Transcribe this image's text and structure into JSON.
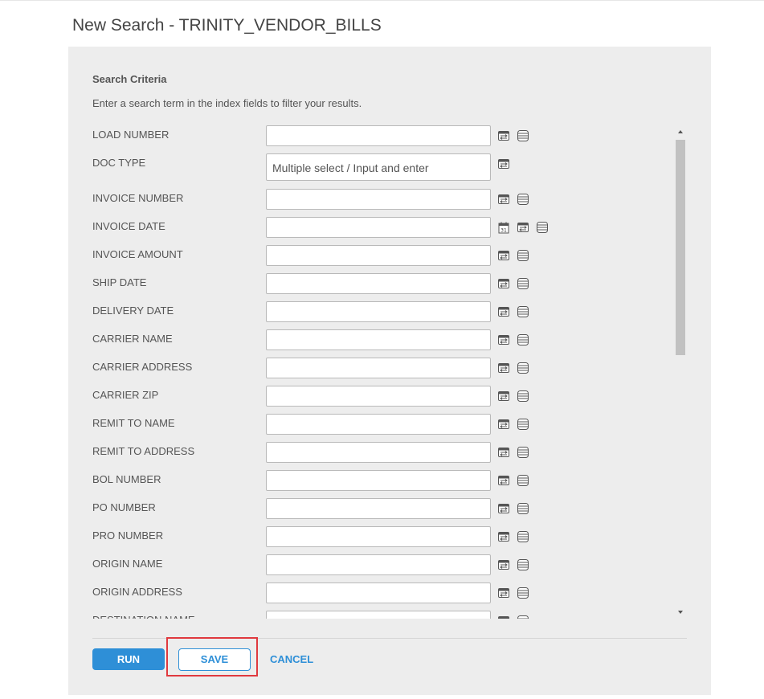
{
  "page": {
    "title": "New Search - TRINITY_VENDOR_BILLS"
  },
  "criteria": {
    "heading": "Search Criteria",
    "description": "Enter a search term in the index fields to filter your results."
  },
  "fields": [
    {
      "label": "LOAD NUMBER",
      "icons": [
        "filter-icon",
        "list-icon"
      ]
    },
    {
      "label": "DOC TYPE",
      "placeholder": "Multiple select / Input and enter",
      "icons": [
        "filter-icon"
      ]
    },
    {
      "label": "INVOICE NUMBER",
      "icons": [
        "filter-icon",
        "list-icon"
      ]
    },
    {
      "label": "INVOICE DATE",
      "icons": [
        "calendar-icon",
        "filter-icon",
        "list-icon"
      ]
    },
    {
      "label": "INVOICE AMOUNT",
      "icons": [
        "filter-icon",
        "list-icon"
      ]
    },
    {
      "label": "SHIP DATE",
      "icons": [
        "filter-icon",
        "list-icon"
      ]
    },
    {
      "label": "DELIVERY DATE",
      "icons": [
        "filter-icon",
        "list-icon"
      ]
    },
    {
      "label": "CARRIER NAME",
      "icons": [
        "filter-icon",
        "list-icon"
      ]
    },
    {
      "label": "CARRIER ADDRESS",
      "icons": [
        "filter-icon",
        "list-icon"
      ]
    },
    {
      "label": "CARRIER ZIP",
      "icons": [
        "filter-icon",
        "list-icon"
      ]
    },
    {
      "label": "REMIT TO NAME",
      "icons": [
        "filter-icon",
        "list-icon"
      ]
    },
    {
      "label": "REMIT TO ADDRESS",
      "icons": [
        "filter-icon",
        "list-icon"
      ]
    },
    {
      "label": "BOL NUMBER",
      "icons": [
        "filter-icon",
        "list-icon"
      ]
    },
    {
      "label": "PO NUMBER",
      "icons": [
        "filter-icon",
        "list-icon"
      ]
    },
    {
      "label": "PRO NUMBER",
      "icons": [
        "filter-icon",
        "list-icon"
      ]
    },
    {
      "label": "ORIGIN NAME",
      "icons": [
        "filter-icon",
        "list-icon"
      ]
    },
    {
      "label": "ORIGIN ADDRESS",
      "icons": [
        "filter-icon",
        "list-icon"
      ]
    },
    {
      "label": "DESTINATION NAME",
      "icons": [
        "filter-icon",
        "list-icon"
      ]
    }
  ],
  "actions": {
    "run_label": "RUN",
    "save_label": "SAVE",
    "cancel_label": "CANCEL"
  },
  "colors": {
    "accent": "#2e8fd7",
    "highlight": "#e0393e",
    "panel_bg": "#ededed"
  }
}
